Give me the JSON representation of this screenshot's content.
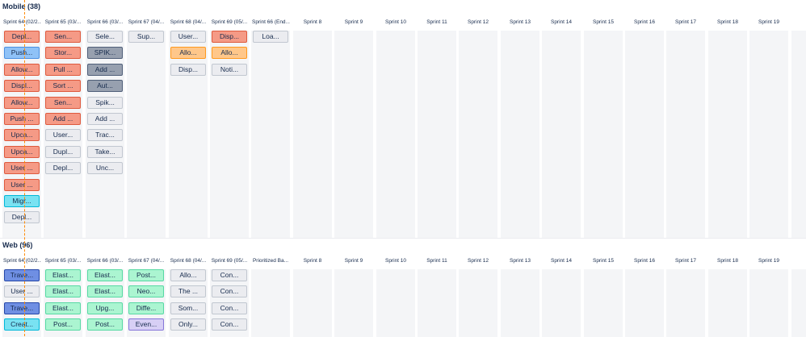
{
  "sections": [
    {
      "title": "Mobile (38)",
      "columns": [
        {
          "header": "Sprint 64 (02/2...",
          "cards": [
            {
              "label": "Depl...",
              "color": "red"
            },
            {
              "label": "Push...",
              "color": "blue"
            },
            {
              "label": "Allow...",
              "color": "red"
            },
            {
              "label": "Displ...",
              "color": "red"
            },
            {
              "label": "Allow...",
              "color": "red"
            },
            {
              "label": "Push ...",
              "color": "red"
            },
            {
              "label": "Upca...",
              "color": "red"
            },
            {
              "label": "Upca...",
              "color": "red"
            },
            {
              "label": "User ...",
              "color": "red"
            },
            {
              "label": "User ...",
              "color": "red"
            },
            {
              "label": "Migr...",
              "color": "cyan"
            },
            {
              "label": "Depl...",
              "color": "grey"
            }
          ]
        },
        {
          "header": "Sprint 65 (03/...",
          "cards": [
            {
              "label": "Sen...",
              "color": "red"
            },
            {
              "label": "Stor...",
              "color": "red"
            },
            {
              "label": "Pull ...",
              "color": "red"
            },
            {
              "label": "Sort ...",
              "color": "red"
            },
            {
              "label": "Sen...",
              "color": "red"
            },
            {
              "label": "Add ...",
              "color": "red"
            },
            {
              "label": "User...",
              "color": "grey"
            },
            {
              "label": "Dupl...",
              "color": "grey"
            },
            {
              "label": "Depl...",
              "color": "grey"
            }
          ]
        },
        {
          "header": "Sprint 66 (03/...",
          "cards": [
            {
              "label": "Sele...",
              "color": "grey"
            },
            {
              "label": "SPIK...",
              "color": "slate"
            },
            {
              "label": "Add ...",
              "color": "slate"
            },
            {
              "label": "Aut...",
              "color": "slate"
            },
            {
              "label": "Spik...",
              "color": "grey"
            },
            {
              "label": "Add ...",
              "color": "grey"
            },
            {
              "label": "Trac...",
              "color": "grey"
            },
            {
              "label": "Take...",
              "color": "grey"
            },
            {
              "label": "Unc...",
              "color": "grey"
            }
          ]
        },
        {
          "header": "Sprint 67 (04/...",
          "cards": [
            {
              "label": "Sup...",
              "color": "grey"
            }
          ]
        },
        {
          "header": "Sprint 68 (04/...",
          "cards": [
            {
              "label": "User...",
              "color": "grey"
            },
            {
              "label": "Allo...",
              "color": "orange"
            },
            {
              "label": "Disp...",
              "color": "grey"
            }
          ]
        },
        {
          "header": "Sprint 69 (05/...",
          "cards": [
            {
              "label": "Disp...",
              "color": "red"
            },
            {
              "label": "Allo...",
              "color": "orange"
            },
            {
              "label": "Noti...",
              "color": "grey"
            }
          ]
        },
        {
          "header": "Sprint 66 (End...",
          "cards": [
            {
              "label": "Loa...",
              "color": "grey"
            }
          ]
        },
        {
          "header": "Sprint 8",
          "cards": []
        },
        {
          "header": "Sprint 9",
          "cards": []
        },
        {
          "header": "Sprint 10",
          "cards": []
        },
        {
          "header": "Sprint 11",
          "cards": []
        },
        {
          "header": "Sprint 12",
          "cards": []
        },
        {
          "header": "Sprint 13",
          "cards": []
        },
        {
          "header": "Sprint 14",
          "cards": []
        },
        {
          "header": "Sprint 15",
          "cards": []
        },
        {
          "header": "Sprint 16",
          "cards": []
        },
        {
          "header": "Sprint 17",
          "cards": []
        },
        {
          "header": "Sprint 18",
          "cards": []
        },
        {
          "header": "Sprint 19",
          "cards": []
        },
        {
          "header": "",
          "cards": []
        }
      ]
    },
    {
      "title": "Web (96)",
      "columns": [
        {
          "header": "Sprint 64 (02/2...",
          "cards": [
            {
              "label": "Trave...",
              "color": "navy"
            },
            {
              "label": "User ...",
              "color": "grey"
            },
            {
              "label": "Trave...",
              "color": "navy"
            },
            {
              "label": "Creat...",
              "color": "cyan"
            }
          ]
        },
        {
          "header": "Sprint 65 (03/...",
          "cards": [
            {
              "label": "Elast...",
              "color": "green"
            },
            {
              "label": "Elast...",
              "color": "green"
            },
            {
              "label": "Elast...",
              "color": "green"
            },
            {
              "label": "Post...",
              "color": "green"
            }
          ]
        },
        {
          "header": "Sprint 66 (03/...",
          "cards": [
            {
              "label": "Elast...",
              "color": "green"
            },
            {
              "label": "Elast...",
              "color": "green"
            },
            {
              "label": "Upg...",
              "color": "green"
            },
            {
              "label": "Post...",
              "color": "green"
            }
          ]
        },
        {
          "header": "Sprint 67 (04/...",
          "cards": [
            {
              "label": "Post...",
              "color": "green"
            },
            {
              "label": "Neo...",
              "color": "green"
            },
            {
              "label": "Diffe...",
              "color": "green"
            },
            {
              "label": "Even...",
              "color": "purple"
            }
          ]
        },
        {
          "header": "Sprint 68 (04/...",
          "cards": [
            {
              "label": "Allo...",
              "color": "grey"
            },
            {
              "label": "The ...",
              "color": "grey"
            },
            {
              "label": "Som...",
              "color": "grey"
            },
            {
              "label": "Only...",
              "color": "grey"
            }
          ]
        },
        {
          "header": "Sprint 69 (05/...",
          "cards": [
            {
              "label": "Con...",
              "color": "grey"
            },
            {
              "label": "Con...",
              "color": "grey"
            },
            {
              "label": "Con...",
              "color": "grey"
            },
            {
              "label": "Con...",
              "color": "grey"
            }
          ]
        },
        {
          "header": "Prioritized Ba...",
          "cards": []
        },
        {
          "header": "Sprint 8",
          "cards": []
        },
        {
          "header": "Sprint 9",
          "cards": []
        },
        {
          "header": "Sprint 10",
          "cards": []
        },
        {
          "header": "Sprint 11",
          "cards": []
        },
        {
          "header": "Sprint 12",
          "cards": []
        },
        {
          "header": "Sprint 13",
          "cards": []
        },
        {
          "header": "Sprint 14",
          "cards": []
        },
        {
          "header": "Sprint 15",
          "cards": []
        },
        {
          "header": "Sprint 16",
          "cards": []
        },
        {
          "header": "Sprint 17",
          "cards": []
        },
        {
          "header": "Sprint 18",
          "cards": []
        },
        {
          "header": "Sprint 19",
          "cards": []
        },
        {
          "header": "",
          "cards": []
        }
      ]
    }
  ],
  "colors": {
    "red": "#f59a86",
    "grey": "#ebecf0",
    "blue": "#8fc2f7",
    "cyan": "#79e2f2",
    "slate": "#97a0af",
    "orange": "#ffc78a",
    "navy": "#6f8fe3",
    "green": "#abf5d1",
    "purple": "#d7cff5",
    "today_line": "#ff8b00"
  }
}
